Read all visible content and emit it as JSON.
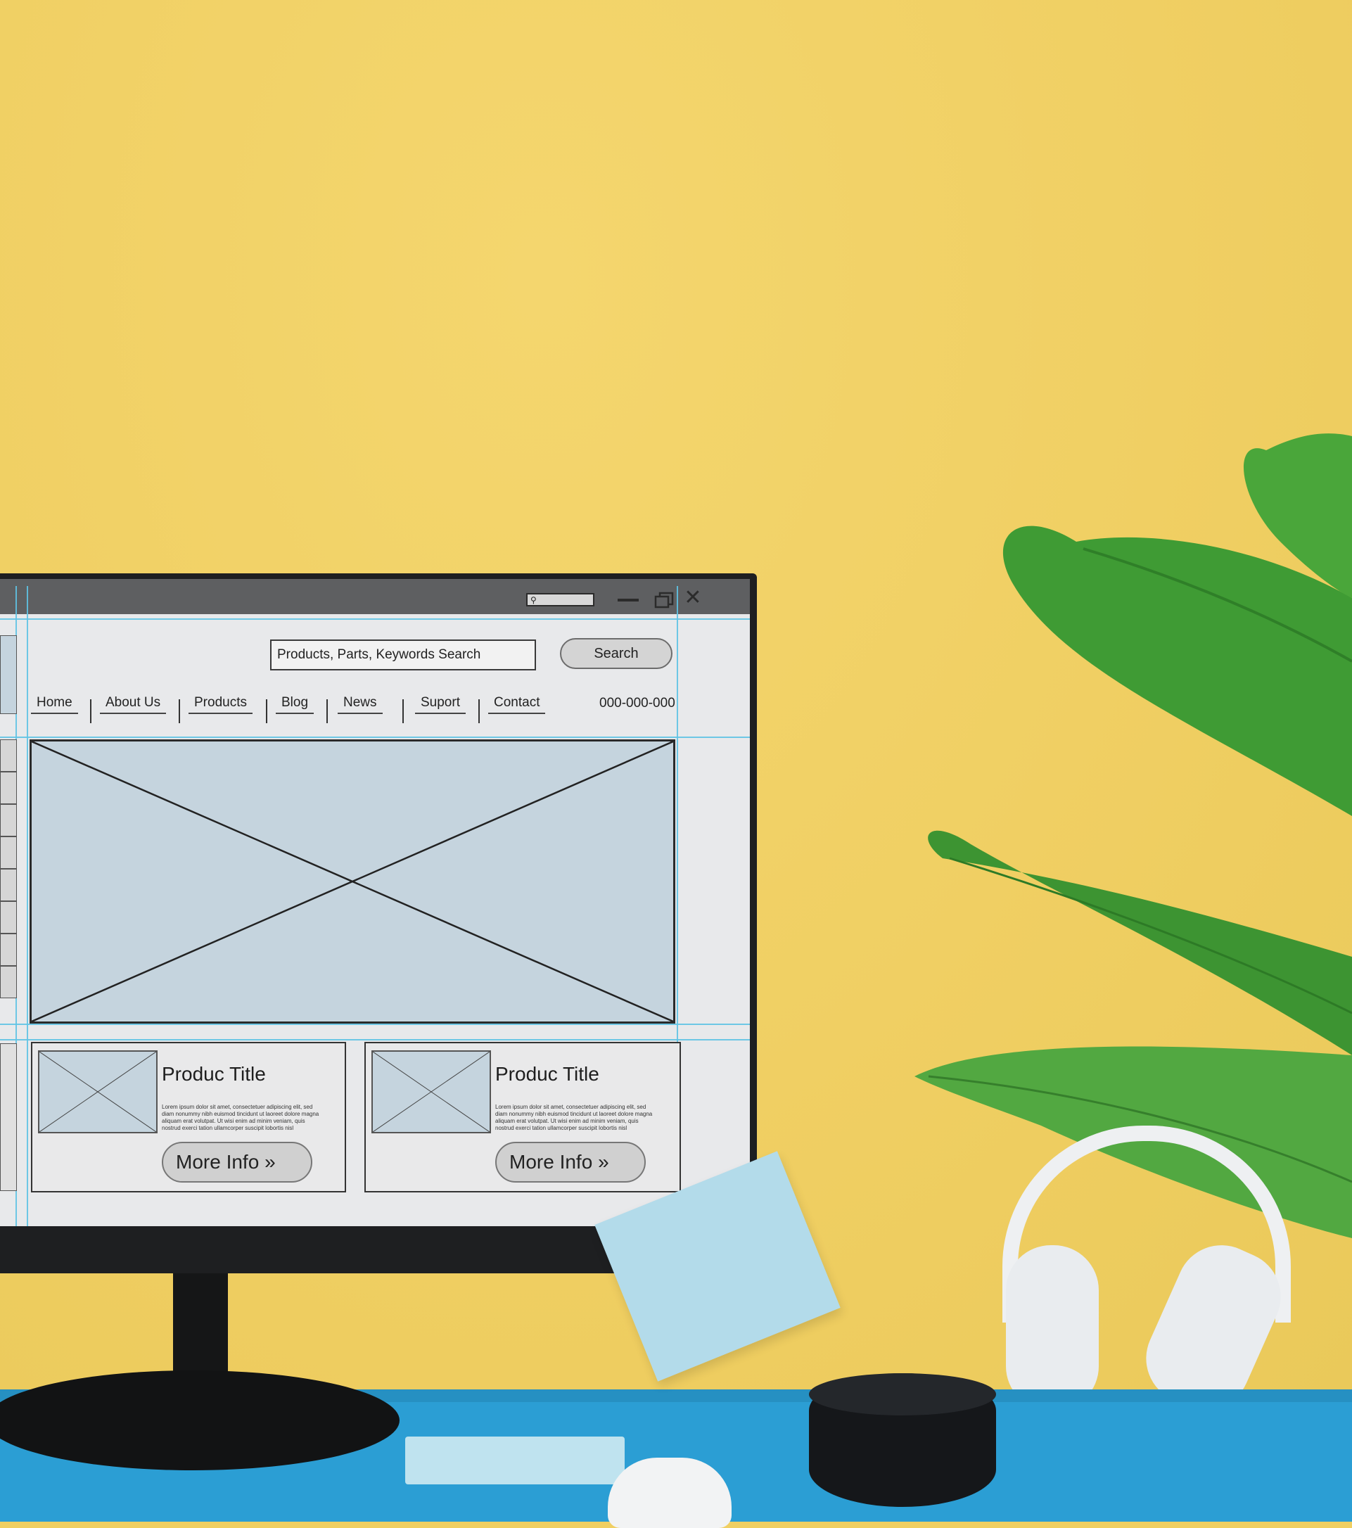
{
  "window": {
    "title_controls": [
      "search-box",
      "minimize",
      "maximize",
      "close"
    ]
  },
  "search": {
    "placeholder": "Products, Parts, Keywords Search",
    "button_label": "Search"
  },
  "nav": {
    "items": [
      "Home",
      "About Us",
      "Products",
      "Blog",
      "News",
      "Suport",
      "Contact"
    ],
    "phone": "000-000-000"
  },
  "hero": {
    "type": "image-placeholder"
  },
  "cards": [
    {
      "title": "Produc Title",
      "body": "Lorem ipsum dolor sit amet, consectetuer adipiscing elit, sed diam nonummy nibh euismod tincidunt ut laoreet dolore magna aliquam erat volutpat. Ut wisi enim ad minim veniam, quis nostrud exerci tation ullamcorper suscipit lobortis nisl",
      "button_label": "More Info",
      "button_icon": "double-chevron-right-icon"
    },
    {
      "title": "Produc Title",
      "body": "Lorem ipsum dolor sit amet, consectetuer adipiscing elit, sed diam nonummy nibh euismod tincidunt ut laoreet dolore magna aliquam erat volutpat. Ut wisi enim ad minim veniam, quis nostrud exerci tation ullamcorper suscipit lobortis nisl",
      "button_label": "More Info",
      "button_icon": "double-chevron-right-icon"
    }
  ],
  "colors": {
    "wall": "#f0cf62",
    "desk": "#2b9ed4",
    "guides": "#5fc3e4",
    "placeholder_fill": "#c5d4de",
    "plant": "#3f9b34"
  }
}
